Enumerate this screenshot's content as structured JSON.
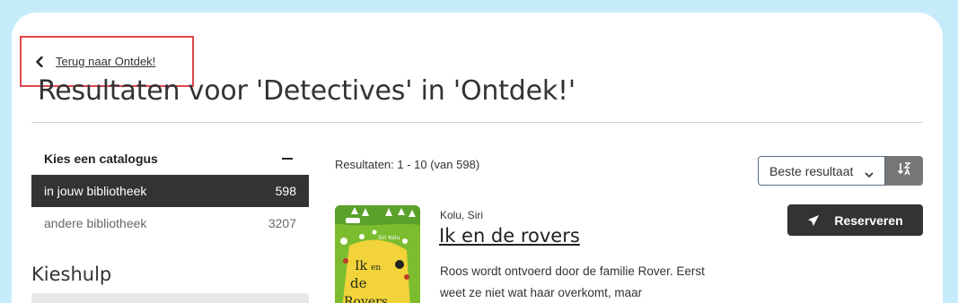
{
  "back_link": {
    "label": "Terug naar Ontdek!"
  },
  "page_title": "Resultaten voor 'Detectives' in 'Ontdek!'",
  "catalog": {
    "heading": "Kies een catalogus",
    "items": [
      {
        "label": "in jouw bibliotheek",
        "count": "598",
        "active": true
      },
      {
        "label": "andere bibliotheek",
        "count": "3207",
        "active": false
      }
    ]
  },
  "kieshulp": {
    "heading": "Kieshulp"
  },
  "results": {
    "summary": "Resultaten: 1 - 10 (van 598)",
    "sort": {
      "selected": "Beste resultaat"
    }
  },
  "book": {
    "author": "Kolu, Siri",
    "title": "Ik en de rovers",
    "description": "Roos wordt ontvoerd door de familie Rover. Eerst weet ze niet wat haar overkomt, maar",
    "cover_title": "Ik en de Rovers",
    "cover_author": "Siri Kolu",
    "reserve_label": "Reserveren"
  },
  "colors": {
    "background": "#c6ecfb",
    "highlight_border": "#e0474c",
    "active_item": "#333333",
    "cover_green": "#7bbd2f"
  },
  "icons": {
    "back": "chevron-left-icon",
    "collapse": "minus-icon",
    "dropdown": "chevron-down-icon",
    "sort": "sort-order-icon",
    "reserve": "paper-plane-icon"
  }
}
